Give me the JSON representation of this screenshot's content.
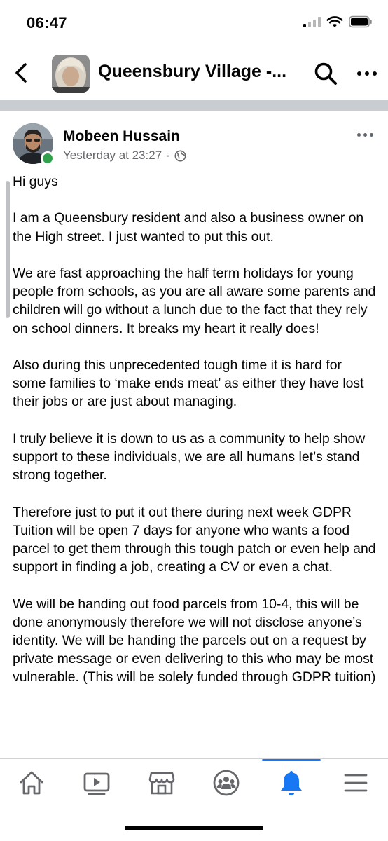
{
  "status_bar": {
    "time": "06:47"
  },
  "header": {
    "group_title": "Queensbury Village -..."
  },
  "post": {
    "author": "Mobeen Hussain",
    "timestamp": "Yesterday at 23:27",
    "separator": "·",
    "paragraphs": [
      "Hi guys",
      "I am a Queensbury resident and also a business owner on the High street. I just wanted to put this out.",
      "We are fast approaching the half term holidays for young people from schools, as you are all aware some parents and children will go without a lunch due to the fact that they rely on school dinners. It breaks my heart it really does!",
      "Also during this unprecedented tough time it is hard for some families to ‘make ends meat’ as either they have lost their jobs or are just about managing.",
      "I truly believe it is down to us as a community to help show support to these individuals, we are all humans let’s stand strong together.",
      "Therefore just to put it out there during next week GDPR Tuition will be open 7 days for anyone who wants a food parcel to get them through this tough patch or even help and support in finding a job, creating a CV or even a chat.",
      "We will be handing out food parcels from 10-4, this will be done anonymously therefore we will not disclose anyone’s identity. We will be handing the parcels out on a request by private message or even delivering to this who may be most vulnerable. (This will be solely funded through GDPR tuition)"
    ]
  },
  "tabbar": {
    "active_tab": "notifications",
    "tabs": [
      "home",
      "watch",
      "marketplace",
      "groups",
      "notifications",
      "menu"
    ]
  },
  "colors": {
    "accent": "#1877f2",
    "online": "#31a24c",
    "meta_text": "#65676b",
    "divider": "#c9ccd1"
  },
  "icons": {
    "back": "chevron-left-icon",
    "search": "search-icon",
    "more": "more-dots-icon",
    "privacy": "globe-icon"
  }
}
